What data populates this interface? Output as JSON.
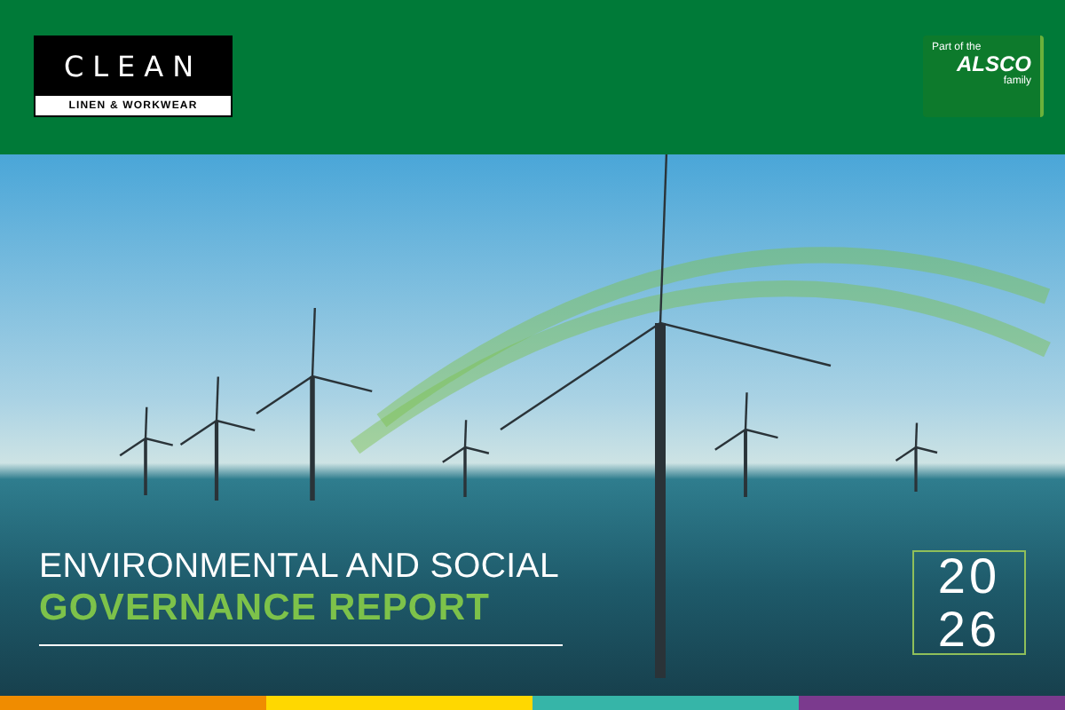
{
  "header": {
    "logo": {
      "name": "CLEAN",
      "tagline": "LINEN & WORKWEAR"
    },
    "parent_badge": {
      "prefix": "Part of the",
      "brand": "ALSCO",
      "suffix": "family"
    }
  },
  "cover": {
    "title_line_1": "ENVIRONMENTAL AND SOCIAL",
    "title_line_2": "GOVERNANCE REPORT",
    "year": [
      "20",
      "26"
    ]
  }
}
